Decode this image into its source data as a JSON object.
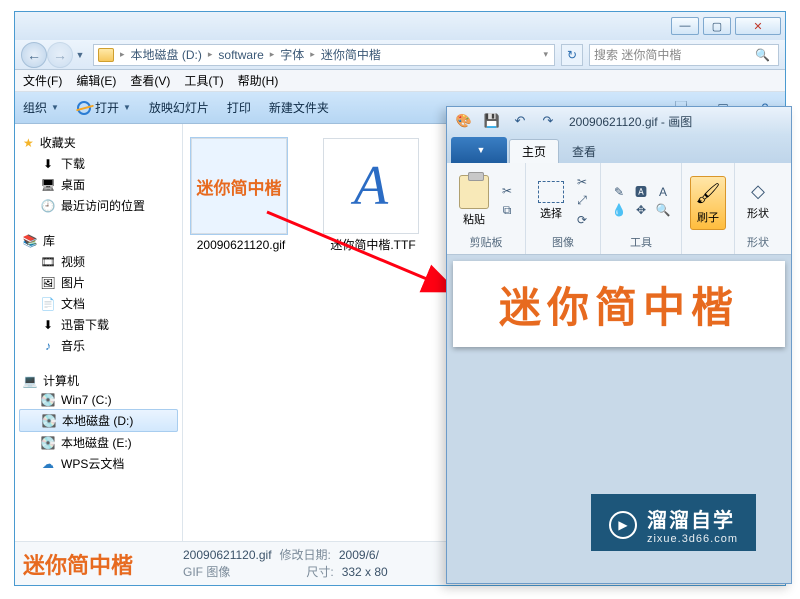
{
  "explorer": {
    "window_buttons": {
      "min": "—",
      "max": "▢",
      "close": "✕"
    },
    "address": {
      "segments": [
        "本地磁盘 (D:)",
        "software",
        "字体",
        "迷你简中楷"
      ]
    },
    "refresh_glyph": "↻",
    "search_placeholder": "搜索 迷你简中楷",
    "menu": [
      "文件(F)",
      "编辑(E)",
      "查看(V)",
      "工具(T)",
      "帮助(H)"
    ],
    "toolbar": {
      "organize": "组织",
      "open": "打开",
      "slideshow": "放映幻灯片",
      "print": "打印",
      "newfolder": "新建文件夹"
    },
    "sidebar": {
      "favorites": {
        "label": "收藏夹",
        "items": [
          "下载",
          "桌面",
          "最近访问的位置"
        ]
      },
      "libraries": {
        "label": "库",
        "items": [
          "视频",
          "图片",
          "文档",
          "迅雷下载",
          "音乐"
        ]
      },
      "computer": {
        "label": "计算机",
        "items": [
          "Win7 (C:)",
          "本地磁盘 (D:)",
          "本地磁盘 (E:)",
          "WPS云文档"
        ]
      }
    },
    "files": [
      {
        "name": "20090621120.gif",
        "preview_text": "迷你简中楷",
        "type": "gif"
      },
      {
        "name": "迷你简中楷.TTF",
        "preview_text": "A",
        "type": "ttf"
      }
    ],
    "status": {
      "preview_text": "迷你简中楷",
      "filename": "20090621120.gif",
      "mod_label": "修改日期:",
      "mod_value": "2009/6/",
      "type_value": "GIF 图像",
      "dim_label": "尺寸:",
      "dim_value": "332 x 80"
    }
  },
  "paint": {
    "doc_title": "20090621120.gif - 画图",
    "quick": {
      "save": "💾",
      "undo": "↶",
      "redo": "↷"
    },
    "file_tab": "",
    "tabs": [
      "主页",
      "查看"
    ],
    "ribbon": {
      "clipboard": {
        "paste": "粘贴",
        "label": "剪贴板",
        "cut": "✂",
        "copy": "⧉"
      },
      "image": {
        "select": "选择",
        "label": "图像"
      },
      "tools": {
        "label": "工具",
        "items": [
          "✎",
          "🅰",
          "A",
          "💧",
          "✥",
          "🔍"
        ]
      },
      "brush": {
        "label": "刷子"
      },
      "shapes": {
        "label": "形状"
      }
    },
    "canvas_text": "迷你简中楷"
  },
  "watermark": {
    "title": "溜溜自学",
    "url": "zixue.3d66.com"
  }
}
